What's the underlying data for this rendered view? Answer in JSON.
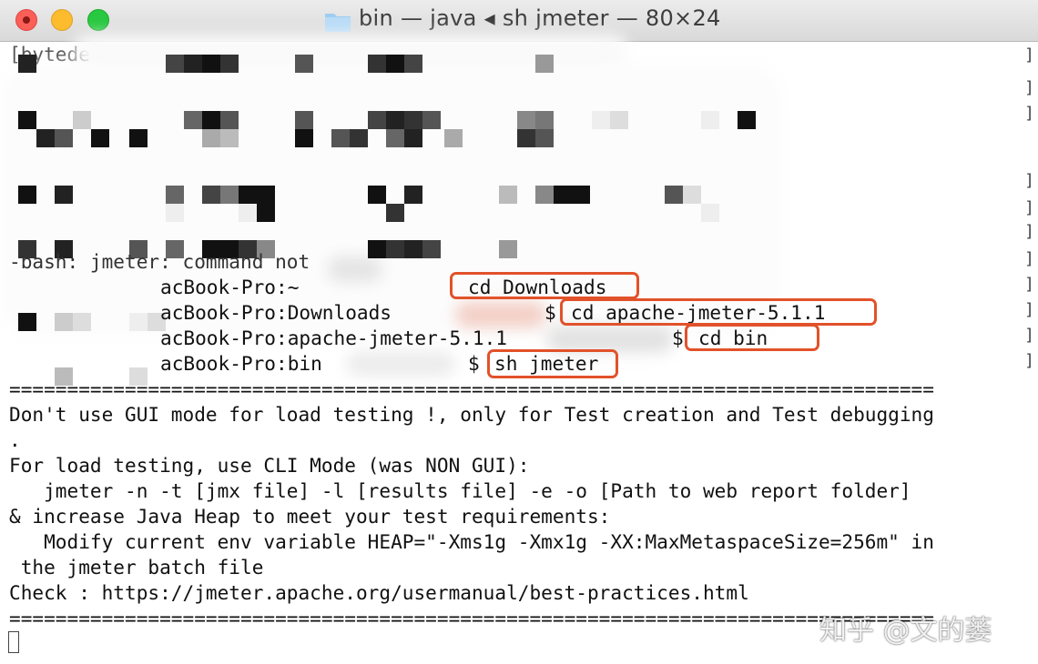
{
  "window": {
    "title": "bin — java ◂ sh jmeter — 80×24",
    "folder_icon": "folder-icon",
    "controls": [
      "close-button",
      "minimize-button",
      "zoom-button"
    ]
  },
  "colors": {
    "highlight": "#e2522a",
    "close": "#fc5f57",
    "minimize": "#fdbc2e",
    "zoom": "#28c840"
  },
  "terminal": {
    "lines": {
      "l0": "[bytede",
      "l8": "-bash: jmeter: command not",
      "l9_prompt": "acBook-Pro:~",
      "l9_cmd": "cd Downloads",
      "l10_prompt": "acBook-Pro:Downloads",
      "l10_dollar": "$",
      "l10_cmd": "cd apache-jmeter-5.1.1",
      "l11_prompt": "acBook-Pro:apache-jmeter-5.1.1",
      "l11_dollar": "$",
      "l11_cmd": "cd bin",
      "l12_prompt": "acBook-Pro:bin",
      "l12_dollar": "$",
      "l12_cmd": "sh jmeter",
      "sep1": "================================================================================",
      "l14": "Don't use GUI mode for load testing !, only for Test creation and Test debugging",
      "l15": ".",
      "l16": "For load testing, use CLI Mode (was NON GUI):",
      "l17": "   jmeter -n -t [jmx file] -l [results file] -e -o [Path to web report folder]",
      "l18": "& increase Java Heap to meet your test requirements:",
      "l19": "   Modify current env variable HEAP=\"-Xms1g -Xmx1g -XX:MaxMetaspaceSize=256m\" in",
      "l20": " the jmeter batch file",
      "l21": "Check : https://jmeter.apache.org/usermanual/best-practices.html",
      "sep2": "================================================================================"
    }
  },
  "watermark": "知乎 @文的蒌"
}
